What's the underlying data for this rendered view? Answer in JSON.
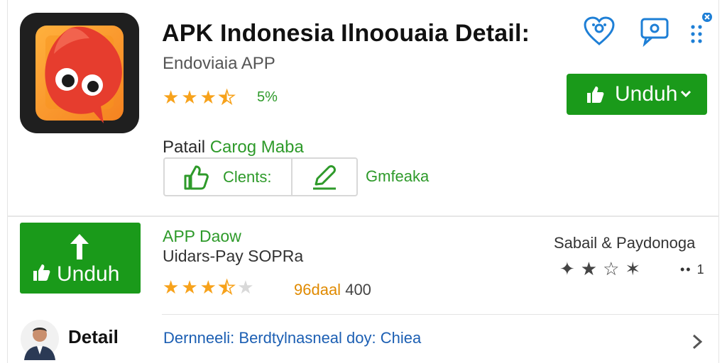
{
  "app": {
    "title": "APK Indonesia Ilnoouaia Detail:",
    "subtitle": "Endoviaia APP",
    "rating_text": "5%",
    "stars": [
      1,
      1,
      1,
      0.5
    ]
  },
  "header_icons": [
    "location-heart-icon",
    "chat-icon",
    "menu-dots-icon"
  ],
  "primary_button": {
    "label": "Unduh"
  },
  "detail_category": {
    "prefix": "Patail",
    "value": "Carog Maba"
  },
  "segment": {
    "left_label": "Clents:",
    "side_label": "Gmfeaka"
  },
  "download_tile": {
    "label": "Unduh"
  },
  "app2": {
    "title": "APP Daow",
    "subtitle": "Uidars-Pay SOPRa",
    "stars": [
      1,
      1,
      1,
      0.5,
      0
    ],
    "rating_label": "96daal",
    "rating_count": "400"
  },
  "side": {
    "title": "Sabail & Paydonoga",
    "count": "•• 1"
  },
  "footer": {
    "label": "Detail",
    "text": "Dernneeli: Berdtylnasneal doy: Chiea"
  },
  "colors": {
    "green": "#1a9a1a",
    "star": "#f7a21b",
    "link": "#1c5fb3"
  }
}
